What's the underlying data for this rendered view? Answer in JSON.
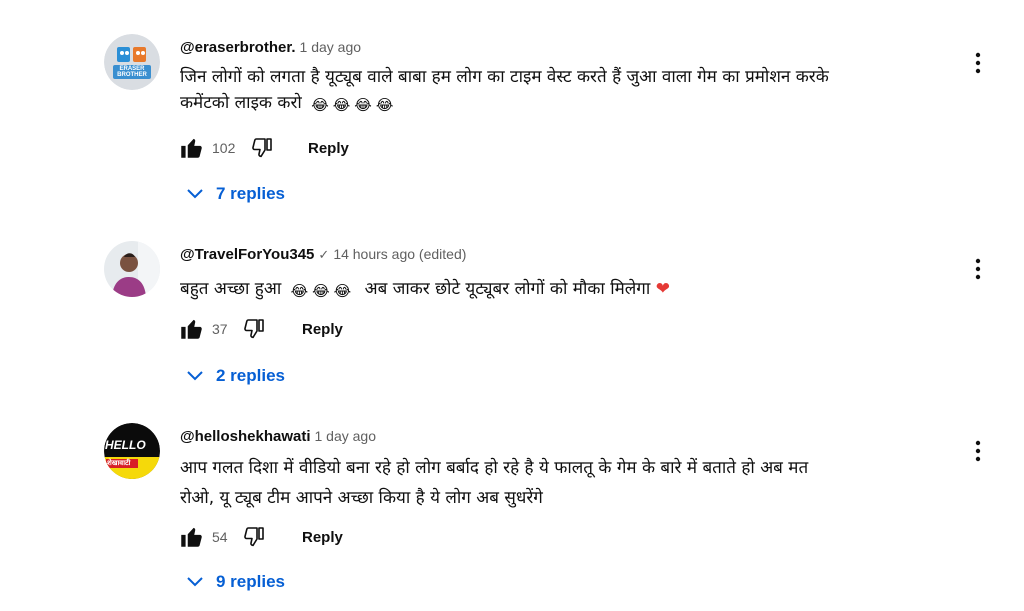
{
  "comments": [
    {
      "author": "@eraserbrother.",
      "time": "1 day ago",
      "text_lines": [
        "जिन लोगों को लगता है यूट्यूब वाले बाबा हम लोग का टाइम वेस्ट करते हैं जुआ वाला गेम का प्रमोशन करके",
        "कमेंटको लाइक करो"
      ],
      "emoji": [
        "😂",
        "😂",
        "😂",
        "😂"
      ],
      "likes": "102",
      "reply_label": "Reply",
      "replies_label": "7 replies",
      "avatar_text": "ERASER BROTHER"
    },
    {
      "author": "@TravelForYou345",
      "verified": "✓",
      "time": "14 hours ago (edited)",
      "text_before": "बहुत अच्छा हुआ",
      "emoji": [
        "😂",
        "😂",
        "😂"
      ],
      "text_after": "अब जाकर छोटे यूट्यूबर लोगों को मौका मिलेगा",
      "heart": "❤",
      "likes": "37",
      "reply_label": "Reply",
      "replies_label": "2 replies"
    },
    {
      "author": "@helloshekhawati",
      "time": "1 day ago",
      "text_lines": [
        "आप गलत दिशा में वीडियो बना रहे हो लोग बर्बाद हो रहे है ये फालतू के गेम के बारे में बताते हो अब मत",
        "रोओ, यू ट्यूब टीम आपने अच्छा किया है ये लोग अब सुधरेंगे"
      ],
      "likes": "54",
      "reply_label": "Reply",
      "replies_label": "9 replies",
      "avatar_text_1": "HELLO",
      "avatar_text_2": "शेखावाटी"
    }
  ],
  "icons": {
    "like": "thumbs-up-icon",
    "dislike": "thumbs-down-icon",
    "more": "vertical-dots-icon",
    "expand": "chevron-down-icon"
  },
  "colors": {
    "link_blue": "#065fd4",
    "meta_gray": "#606060",
    "text": "#0f0f0f"
  }
}
